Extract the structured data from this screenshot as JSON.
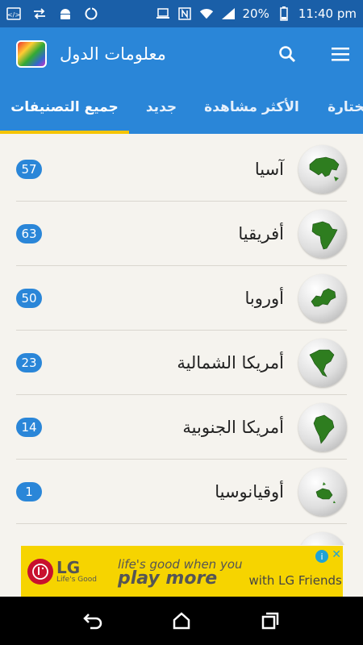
{
  "status_bar": {
    "battery": "20%",
    "time": "11:40 pm",
    "icons": [
      "code-icon",
      "sync-arrows-icon",
      "android-icon",
      "circle-notification-icon",
      "laptop-icon",
      "nfc-icon",
      "wifi-icon",
      "signal-icon",
      "battery-icon"
    ]
  },
  "app_bar": {
    "title": "معلومات الدول",
    "logo_icon": "flags-app-logo",
    "actions": [
      "search-icon",
      "menu-icon"
    ]
  },
  "tabs": [
    {
      "label": "جميع التصنيفات",
      "active": true
    },
    {
      "label": "جديد",
      "active": false
    },
    {
      "label": "الأكثر مشاهدة",
      "active": false
    },
    {
      "label": "مختارة",
      "active": false
    }
  ],
  "categories": [
    {
      "name": "آسيا",
      "count": "57",
      "icon": "asia-globe-icon"
    },
    {
      "name": "أفريقيا",
      "count": "63",
      "icon": "africa-globe-icon"
    },
    {
      "name": "أوروبا",
      "count": "50",
      "icon": "europe-globe-icon"
    },
    {
      "name": "أمريكا الشمالية",
      "count": "23",
      "icon": "north-america-globe-icon"
    },
    {
      "name": "أمريكا الجنوبية",
      "count": "14",
      "icon": "south-america-globe-icon"
    },
    {
      "name": "أوقيانوسيا",
      "count": "1",
      "icon": "oceania-globe-icon"
    }
  ],
  "ad": {
    "brand": "LG",
    "brand_tagline": "Life's Good",
    "slogan_line1": "life's good when you",
    "slogan_line2": "play more",
    "friends": "with LG Friends",
    "info_icon": "info-icon",
    "close_icon": "close-icon"
  },
  "colors": {
    "status_bar": "#1a5fa8",
    "primary": "#2a86d8",
    "accent": "#f5c400",
    "continent_green": "#2e7d1f",
    "background": "#f5f3ee"
  }
}
